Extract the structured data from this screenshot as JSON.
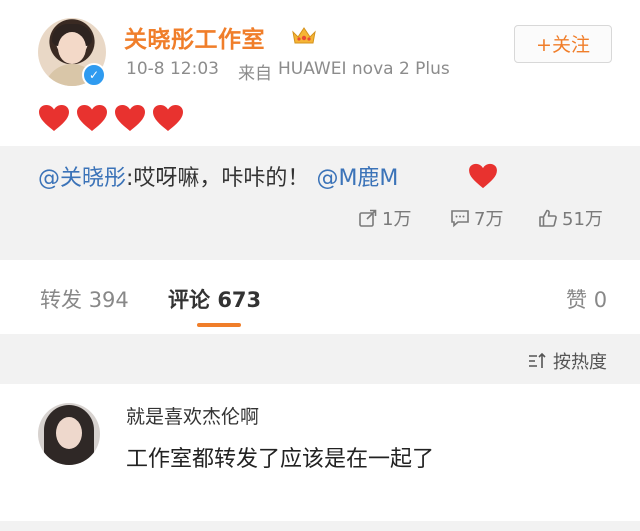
{
  "post": {
    "author": "关晓彤工作室",
    "time": "10-8 12:03",
    "source_label": "来自",
    "device": "HUAWEI nova 2 Plus",
    "follow_label": "+关注",
    "icons": [
      "avatar",
      "verified-badge-icon",
      "crown-icon",
      "heart-icon"
    ]
  },
  "quote": {
    "mention": "@关晓彤",
    "text": ":哎呀嘛，咔咔的！",
    "mention2": "@M鹿M",
    "stats": {
      "repost": "1万",
      "comment": "7万",
      "like": "51万"
    }
  },
  "tabs": {
    "repost_label": "转发",
    "repost_count": "394",
    "comment_label": "评论",
    "comment_count": "673",
    "like_label": "赞",
    "like_count": "0"
  },
  "sort": {
    "label": "按热度"
  },
  "comment": {
    "username": "就是喜欢杰伦啊",
    "text": "工作室都转发了应该是在一起了"
  },
  "colors": {
    "accent": "#f07e2a",
    "link": "#3b73b8",
    "heart": "#e8322f",
    "verified": "#2f9bf0"
  }
}
